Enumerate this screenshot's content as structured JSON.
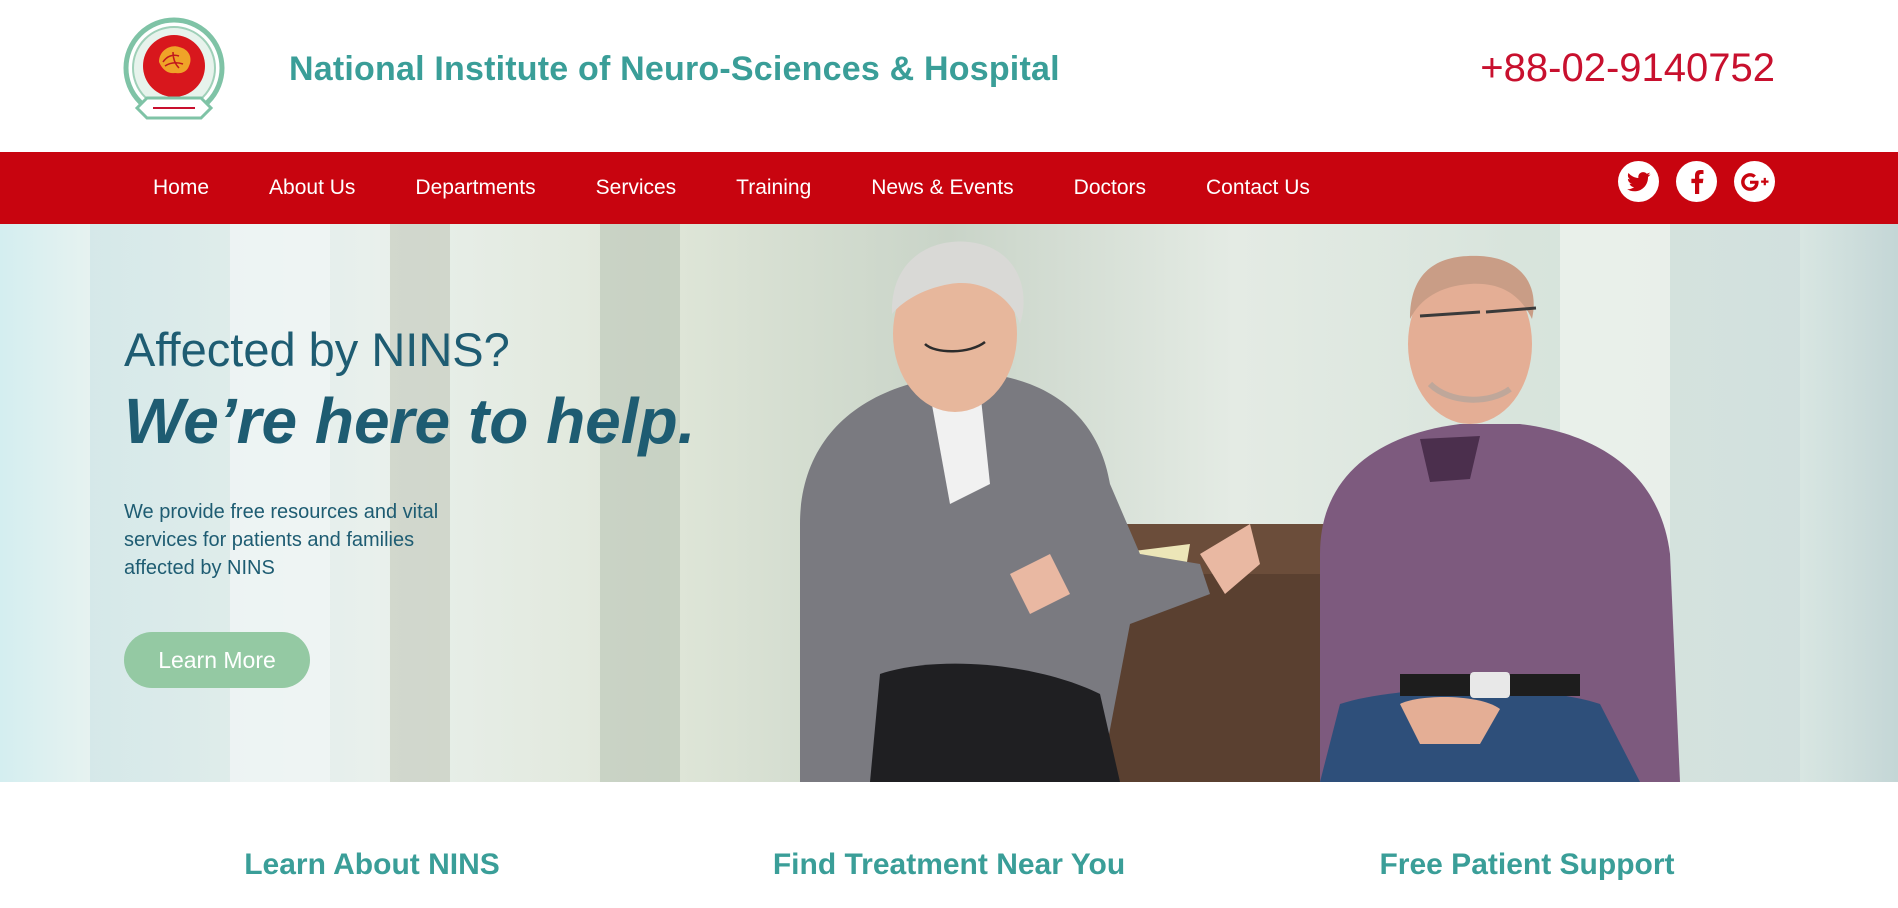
{
  "header": {
    "title": "National Institute of Neuro-Sciences & Hospital",
    "phone": "+88-02-9140752"
  },
  "nav": {
    "items": [
      {
        "label": "Home"
      },
      {
        "label": "About Us"
      },
      {
        "label": "Departments"
      },
      {
        "label": "Services"
      },
      {
        "label": "Training"
      },
      {
        "label": "News & Events"
      },
      {
        "label": "Doctors"
      },
      {
        "label": "Contact Us"
      }
    ],
    "social": [
      {
        "icon": "twitter-icon"
      },
      {
        "icon": "facebook-icon"
      },
      {
        "icon": "google-plus-icon"
      }
    ]
  },
  "hero": {
    "pre_title": "Affected by NINS?",
    "title": "We’re here to help.",
    "description": "We provide free resources and vital services for patients and families affected by NINS",
    "button_label": "Learn More"
  },
  "features": [
    {
      "title": "Learn About NINS"
    },
    {
      "title": "Find Treatment Near You"
    },
    {
      "title": "Free Patient Support"
    }
  ],
  "colors": {
    "brand_teal": "#3a9e98",
    "nav_red": "#c8040f",
    "phone_red": "#c8102e",
    "hero_text": "#1e5c72",
    "button_green": "#94c9a3"
  }
}
